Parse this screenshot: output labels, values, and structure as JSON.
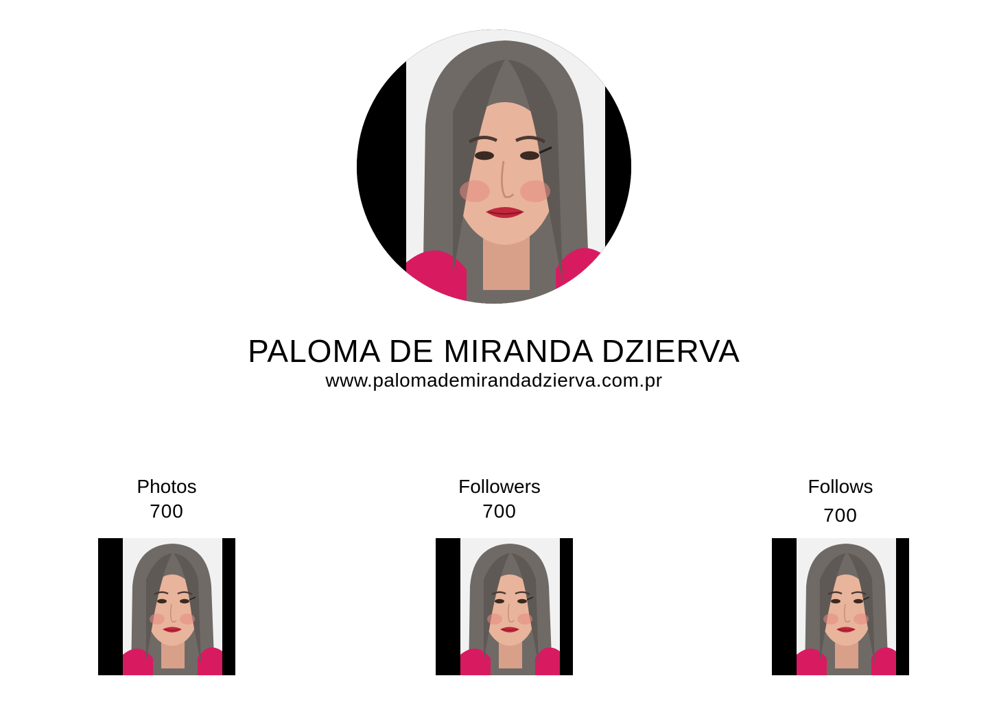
{
  "profile": {
    "name": "PALOMA DE MIRANDA DZIERVA",
    "website": "www.palomademirandadzierva.com.pr",
    "avatar_icon": "profile-photo"
  },
  "stats": [
    {
      "label": "Photos",
      "value": "700"
    },
    {
      "label": "Followers",
      "value": "700"
    },
    {
      "label": "Follows",
      "value": "700"
    }
  ],
  "colors": {
    "background": "#ffffff",
    "text": "#000000",
    "photo_backdrop": "#000000",
    "hair": "#6f6a66",
    "skin": "#e9b49c",
    "lips": "#c0283c",
    "top": "#d81b60"
  }
}
